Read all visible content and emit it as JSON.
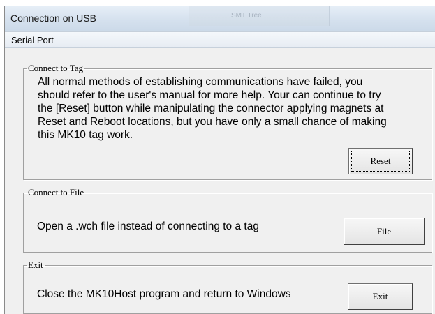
{
  "window": {
    "title": "Connection on USB",
    "background_tab_title": "SMT Tree"
  },
  "menu": {
    "items": [
      {
        "label": "Serial Port"
      }
    ]
  },
  "connect_to_tag": {
    "legend": "Connect to Tag",
    "message": "All normal methods of establishing communications have failed, you\nshould refer to the user's manual for more help.  Your can continue to try\nthe [Reset] button while manipulating the connector applying magnets at\nReset and Reboot locations, but you have only a small chance of making\nthis MK10 tag work.",
    "button_label": "Reset"
  },
  "connect_to_file": {
    "legend": "Connect to File",
    "message": "Open a .wch file instead of connecting to a tag",
    "button_label": "File"
  },
  "exit": {
    "legend": "Exit",
    "message": "Close the MK10Host program and return to Windows",
    "button_label": "Exit"
  }
}
